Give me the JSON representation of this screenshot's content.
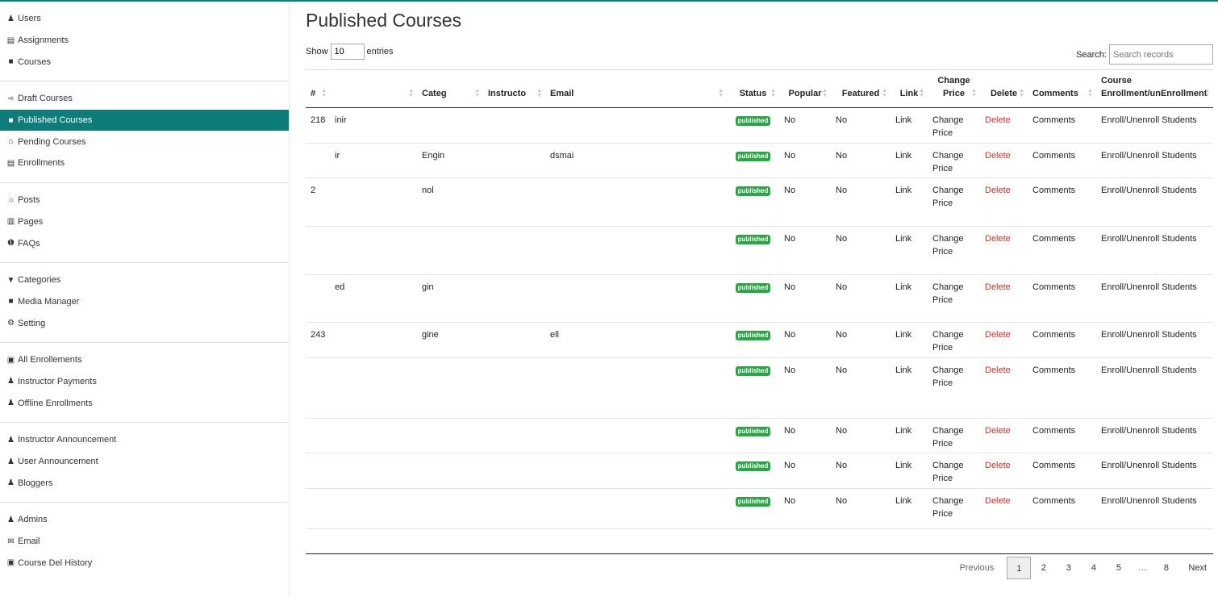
{
  "sidebar": {
    "groups": [
      [
        {
          "label": "Users",
          "icon": "users-icon"
        },
        {
          "label": "Assignments",
          "icon": "book-icon"
        },
        {
          "label": "Courses",
          "icon": "video-icon"
        }
      ],
      [
        {
          "label": "Draft Courses",
          "icon": "rocket-icon"
        },
        {
          "label": "Published Courses",
          "icon": "video-icon",
          "active": true
        },
        {
          "label": "Pending Courses",
          "icon": "bank-icon"
        },
        {
          "label": "Enrollments",
          "icon": "book-icon"
        }
      ],
      [
        {
          "label": "Posts",
          "icon": "comments-icon"
        },
        {
          "label": "Pages",
          "icon": "file-icon"
        },
        {
          "label": "FAQs",
          "icon": "question-icon"
        }
      ],
      [
        {
          "label": "Categories",
          "icon": "filter-icon"
        },
        {
          "label": "Media Manager",
          "icon": "video-icon"
        },
        {
          "label": "Setting",
          "icon": "gear-icon"
        }
      ],
      [
        {
          "label": "All Enrollements",
          "icon": "lock-icon"
        },
        {
          "label": "Instructor Payments",
          "icon": "users-icon"
        },
        {
          "label": "Offline Enrollments",
          "icon": "users-icon"
        }
      ],
      [
        {
          "label": "Instructor Announcement",
          "icon": "users-icon"
        },
        {
          "label": "User Announcement",
          "icon": "users-icon"
        },
        {
          "label": "Bloggers",
          "icon": "users-icon"
        }
      ],
      [
        {
          "label": "Admins",
          "icon": "users-icon"
        },
        {
          "label": "Email",
          "icon": "envelope-icon"
        },
        {
          "label": "Course Del History",
          "icon": "lock-icon"
        }
      ]
    ]
  },
  "main": {
    "title": "Published Courses",
    "show_label": "Show",
    "length_value": "10",
    "entries_label": "entries",
    "search_label": "Search:",
    "search_placeholder": "Search records"
  },
  "table": {
    "headers": [
      "#",
      "",
      "Categ",
      "Instructo",
      "Email",
      "Status",
      "Popular",
      "Featured",
      "Link",
      "Change Price",
      "Delete",
      "Comments",
      "Course Enrollment/unEnrollment"
    ],
    "rows": [
      {
        "id": "218",
        "title": "inir",
        "category": "",
        "email": "",
        "status": "published",
        "popular": "No",
        "featured": "No",
        "link": "Link",
        "change_price": "Change Price",
        "delete": "Delete",
        "comments": "Comments",
        "enroll": "Enroll/Unenroll Students"
      },
      {
        "id": "",
        "title": "ir",
        "category": "Engin",
        "email": "dsmai",
        "status": "published",
        "popular": "No",
        "featured": "No",
        "link": "Link",
        "change_price": "Change Price",
        "delete": "Delete",
        "comments": "Comments",
        "enroll": "Enroll/Unenroll Students"
      },
      {
        "id": "2",
        "title": "",
        "category": "nol",
        "email": "",
        "status": "published",
        "popular": "No",
        "featured": "No",
        "link": "Link",
        "change_price": "Change Price",
        "delete": "Delete",
        "comments": "Comments",
        "enroll": "Enroll/Unenroll Students"
      },
      {
        "id": "",
        "title": "",
        "category": "",
        "email": "",
        "status": "published",
        "popular": "No",
        "featured": "No",
        "link": "Link",
        "change_price": "Change Price",
        "delete": "Delete",
        "comments": "Comments",
        "enroll": "Enroll/Unenroll Students"
      },
      {
        "id": "",
        "title": "ed",
        "category": "gin",
        "email": "",
        "status": "published",
        "popular": "No",
        "featured": "No",
        "link": "Link",
        "change_price": "Change Price",
        "delete": "Delete",
        "comments": "Comments",
        "enroll": "Enroll/Unenroll Students"
      },
      {
        "id": "243",
        "title": "",
        "category": "gine",
        "email": "ell",
        "status": "published",
        "popular": "No",
        "featured": "No",
        "link": "Link",
        "change_price": "Change Price",
        "delete": "Delete",
        "comments": "Comments",
        "enroll": "Enroll/Unenroll Students"
      },
      {
        "id": "",
        "title": "",
        "category": "",
        "email": "",
        "status": "published",
        "popular": "No",
        "featured": "No",
        "link": "Link",
        "change_price": "Change Price",
        "delete": "Delete",
        "comments": "Comments",
        "enroll": "Enroll/Unenroll Students"
      },
      {
        "id": "",
        "title": "",
        "category": "",
        "email": "",
        "status": "published",
        "popular": "No",
        "featured": "No",
        "link": "Link",
        "change_price": "Change Price",
        "delete": "Delete",
        "comments": "Comments",
        "enroll": "Enroll/Unenroll Students"
      },
      {
        "id": "",
        "title": "",
        "category": "",
        "email": "",
        "status": "published",
        "popular": "No",
        "featured": "No",
        "link": "Link",
        "change_price": "Change Price",
        "delete": "Delete",
        "comments": "Comments",
        "enroll": "Enroll/Unenroll Students"
      },
      {
        "id": "",
        "title": "",
        "category": "",
        "email": "",
        "status": "published",
        "popular": "No",
        "featured": "No",
        "link": "Link",
        "change_price": "Change Price",
        "delete": "Delete",
        "comments": "Comments",
        "enroll": "Enroll/Unenroll Students"
      }
    ]
  },
  "pagination": {
    "previous": "Previous",
    "pages": [
      "1",
      "2",
      "3",
      "4",
      "5"
    ],
    "ellipsis": "…",
    "last": "8",
    "next": "Next",
    "current": "1"
  },
  "colors": {
    "accent": "#0e7d7a",
    "badge": "#28a745",
    "delete": "#c9302c"
  }
}
